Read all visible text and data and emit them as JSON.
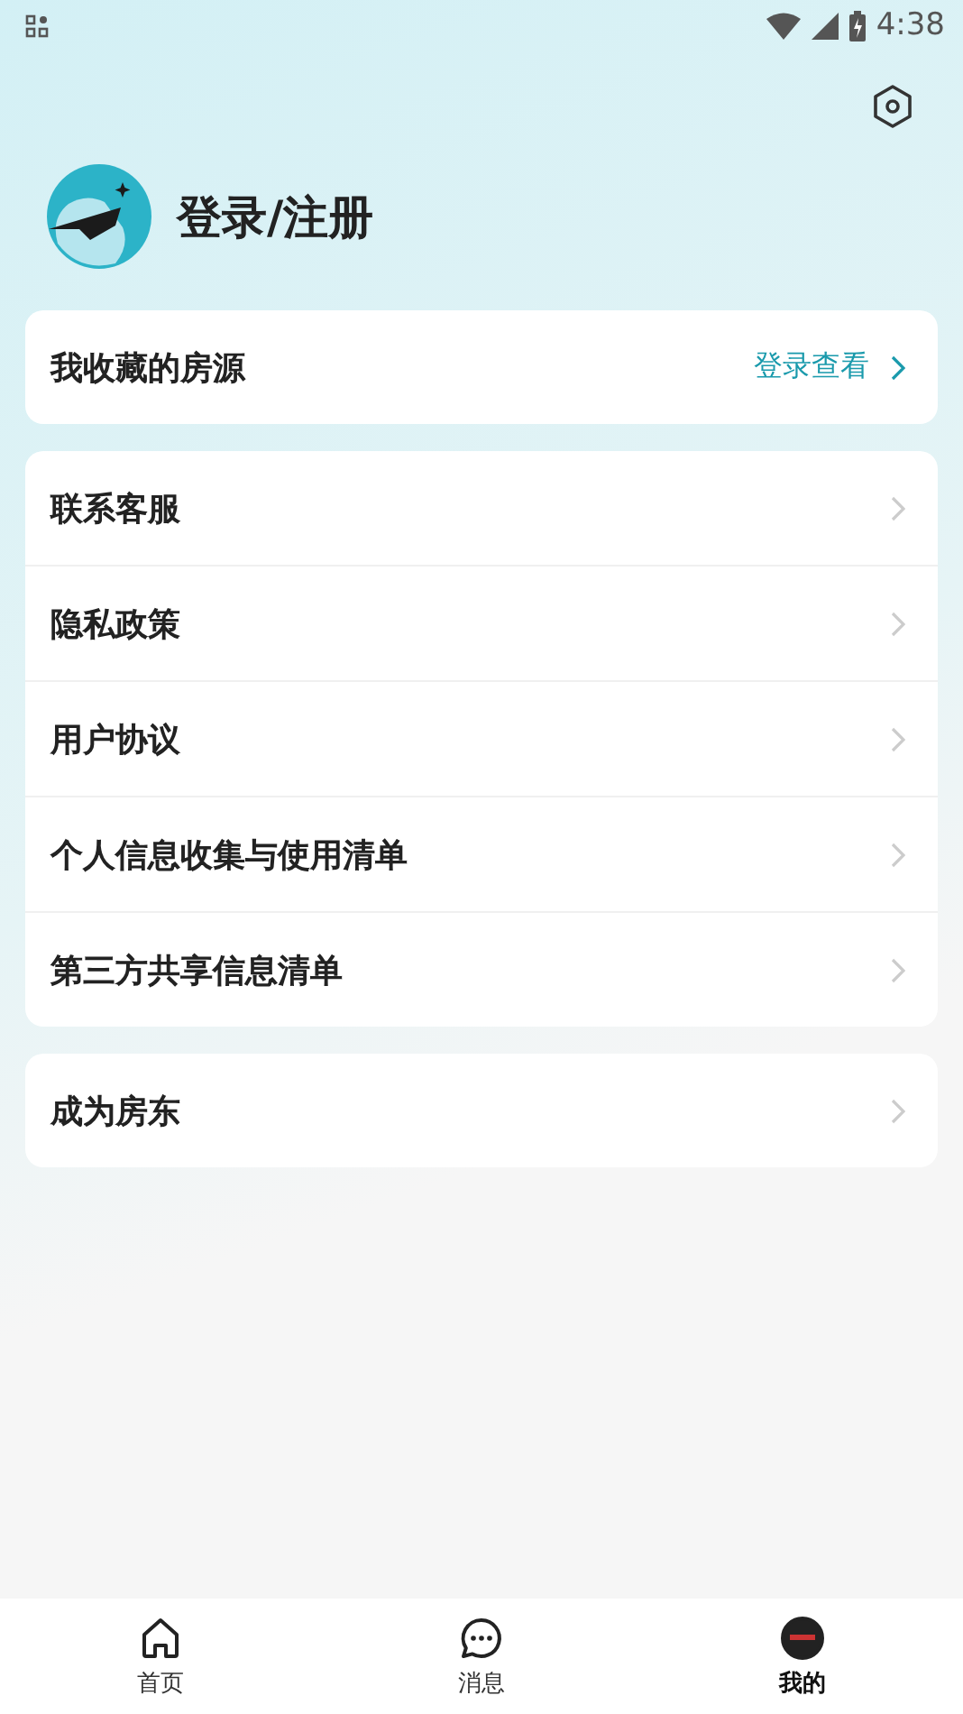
{
  "status_bar": {
    "time": "4:38"
  },
  "profile": {
    "login_label": "登录/注册"
  },
  "favorites": {
    "label": "我收藏的房源",
    "action": "登录查看"
  },
  "menu_groups": [
    {
      "items": [
        "联系客服",
        "隐私政策",
        "用户协议",
        "个人信息收集与使用清单",
        "第三方共享信息清单"
      ]
    },
    {
      "items": [
        "成为房东"
      ]
    }
  ],
  "nav_tabs": [
    {
      "label": "首页",
      "kind": "home",
      "selected": false
    },
    {
      "label": "消息",
      "kind": "messages",
      "selected": false
    },
    {
      "label": "我的",
      "kind": "profile",
      "selected": true
    }
  ]
}
